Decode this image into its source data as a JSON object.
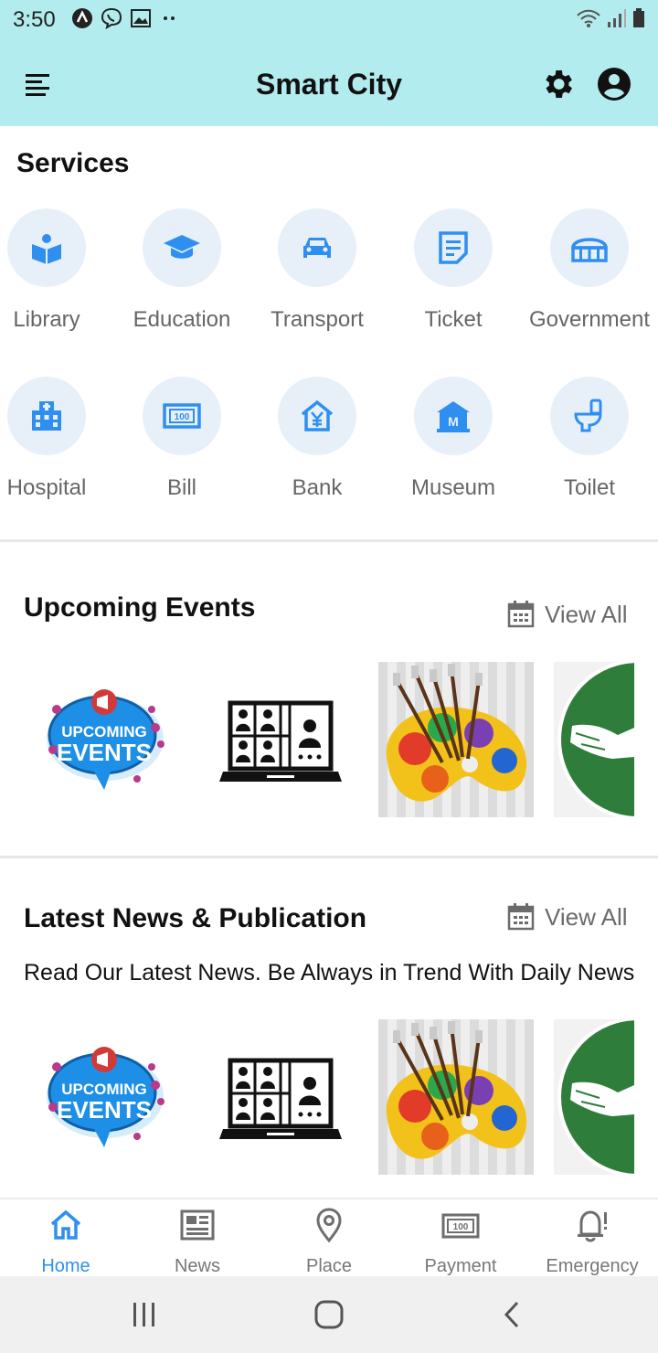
{
  "status": {
    "time": "3:50"
  },
  "header": {
    "title": "Smart City"
  },
  "services": {
    "title": "Services",
    "items": [
      {
        "label": "Library"
      },
      {
        "label": "Education"
      },
      {
        "label": "Transport"
      },
      {
        "label": "Ticket"
      },
      {
        "label": "Government"
      },
      {
        "label": "Hospital"
      },
      {
        "label": "Bill"
      },
      {
        "label": "Bank"
      },
      {
        "label": "Museum"
      },
      {
        "label": "Toilet"
      }
    ]
  },
  "events": {
    "title": "Upcoming Events",
    "view_all": "View All",
    "thumbs": [
      {
        "banner_line1": "UPCOMING",
        "banner_line2": "EVENTS"
      },
      {
        "name": "video-meeting"
      },
      {
        "name": "art-palette"
      },
      {
        "name": "handshake"
      }
    ]
  },
  "news": {
    "title": "Latest News & Publication",
    "view_all": "View All",
    "description": "Read Our Latest News. Be Always in Trend With Daily News",
    "thumbs": [
      {
        "banner_line1": "UPCOMING",
        "banner_line2": "EVENTS"
      },
      {
        "name": "video-meeting"
      },
      {
        "name": "art-palette"
      },
      {
        "name": "handshake"
      }
    ]
  },
  "bottom_nav": {
    "items": [
      {
        "label": "Home",
        "active": true
      },
      {
        "label": "News"
      },
      {
        "label": "Place"
      },
      {
        "label": "Payment"
      },
      {
        "label": "Emergency"
      }
    ]
  },
  "colors": {
    "accent": "#2f8ff0",
    "header_bg": "#b3ecee",
    "icon_circle": "#e7f0f8"
  }
}
